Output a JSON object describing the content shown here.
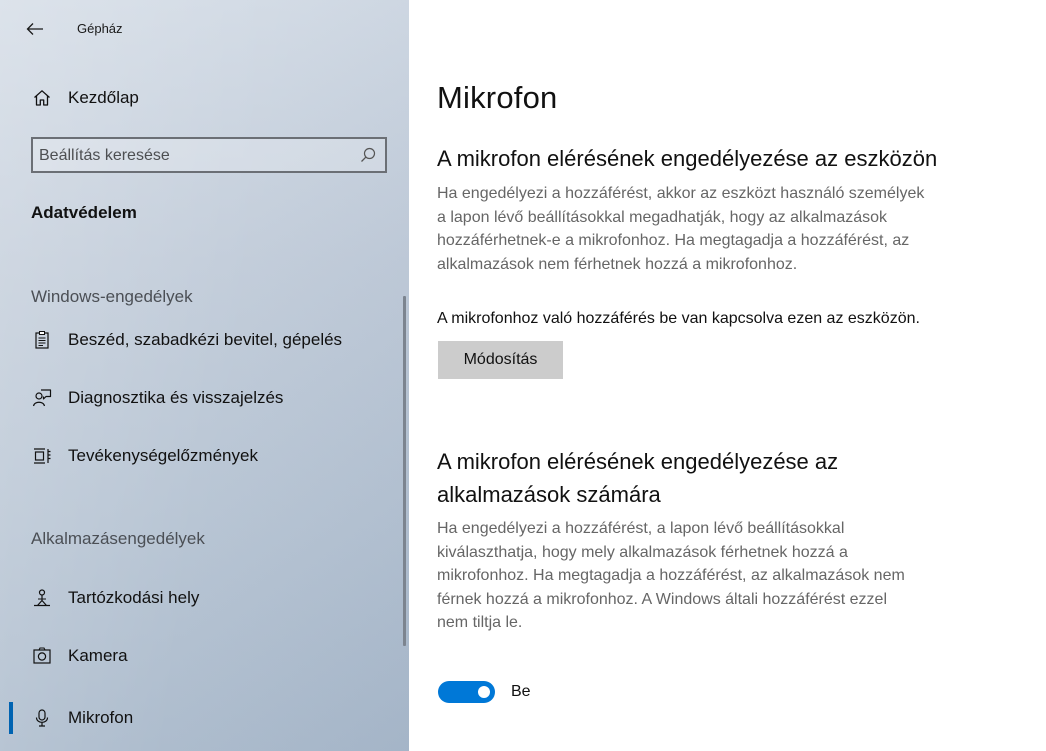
{
  "window": {
    "title": "Gépház"
  },
  "sidebar": {
    "home": {
      "label": "Kezdőlap",
      "icon": "home-icon"
    },
    "search": {
      "placeholder": "Beállítás keresése",
      "value": ""
    },
    "category": "Adatvédelem",
    "groups": [
      {
        "heading": "Windows-engedélyek",
        "items": [
          {
            "label": "Beszéd, szabadkézi bevitel, gépelés",
            "icon": "speech-notepad-icon"
          },
          {
            "label": "Diagnosztika és visszajelzés",
            "icon": "feedback-person-icon"
          },
          {
            "label": "Tevékenységelőzmények",
            "icon": "timeline-icon"
          }
        ]
      },
      {
        "heading": "Alkalmazásengedélyek",
        "items": [
          {
            "label": "Tartózkodási hely",
            "icon": "location-person-icon"
          },
          {
            "label": "Kamera",
            "icon": "camera-icon"
          },
          {
            "label": "Mikrofon",
            "icon": "microphone-icon",
            "selected": true
          }
        ]
      }
    ]
  },
  "content": {
    "title": "Mikrofon",
    "section1": {
      "heading": "A mikrofon elérésének engedélyezése az eszközön",
      "description_lines": [
        "Ha engedélyezi a hozzáférést, akkor az eszközt használó személyek",
        "a lapon lévő beállításokkal megadhatják, hogy az alkalmazások",
        "hozzáférhetnek-e a mikrofonhoz. Ha megtagadja a hozzáférést, az",
        "alkalmazások nem férhetnek hozzá a mikrofonhoz."
      ],
      "status": "A mikrofonhoz való hozzáférés be van kapcsolva ezen az eszközön.",
      "button": "Módosítás"
    },
    "section2": {
      "heading_lines": [
        "A mikrofon elérésének engedélyezése az",
        "alkalmazások számára"
      ],
      "description_lines": [
        "Ha engedélyezi a hozzáférést, a lapon lévő beállításokkal",
        "kiválaszthatja, hogy mely alkalmazások férhetnek hozzá a",
        "mikrofonhoz. Ha megtagadja a hozzáférést, az alkalmazások nem",
        "férnek hozzá a mikrofonhoz. A Windows általi hozzáférést ezzel",
        "nem tiltja le."
      ],
      "toggle": {
        "state": true,
        "label": "Be"
      }
    }
  },
  "colors": {
    "accent": "#0078d7",
    "selection_bar": "#0063b1",
    "button_bg": "#cccccc",
    "description_text": "#666666"
  }
}
